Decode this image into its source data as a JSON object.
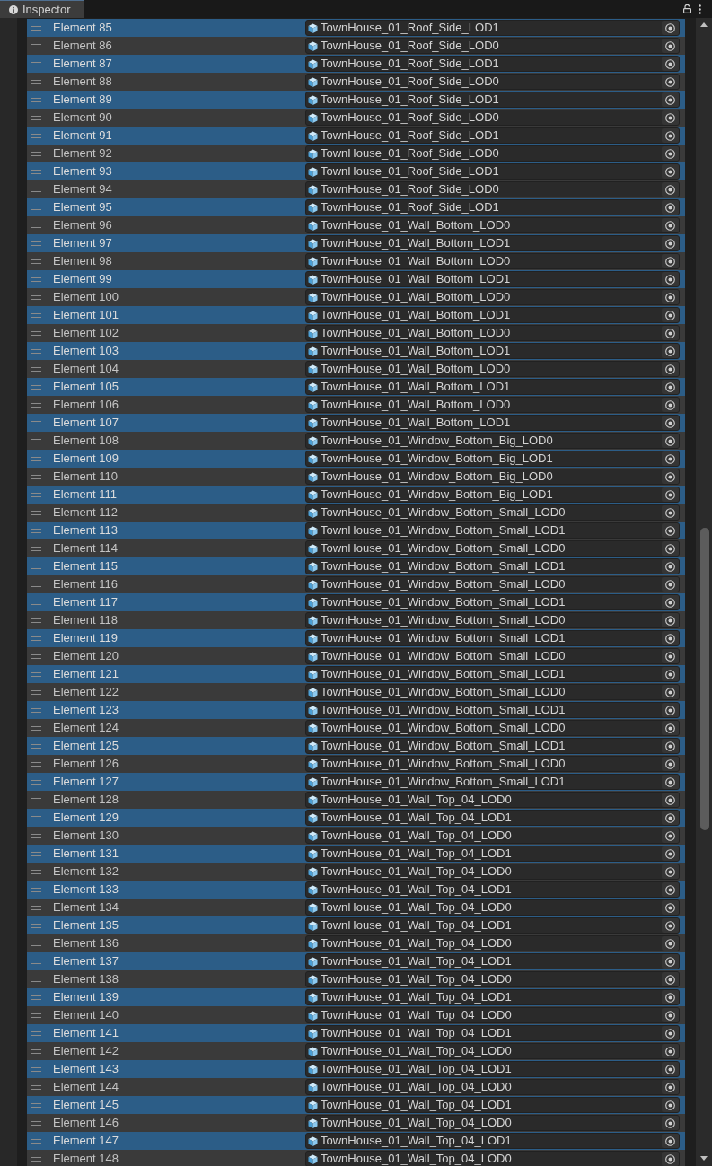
{
  "tab": {
    "title": "Inspector"
  },
  "elements": [
    {
      "label": "Element 85",
      "value": "TownHouse_01_Roof_Side_LOD1",
      "selected": true
    },
    {
      "label": "Element 86",
      "value": "TownHouse_01_Roof_Side_LOD0",
      "selected": false
    },
    {
      "label": "Element 87",
      "value": "TownHouse_01_Roof_Side_LOD1",
      "selected": true
    },
    {
      "label": "Element 88",
      "value": "TownHouse_01_Roof_Side_LOD0",
      "selected": false
    },
    {
      "label": "Element 89",
      "value": "TownHouse_01_Roof_Side_LOD1",
      "selected": true
    },
    {
      "label": "Element 90",
      "value": "TownHouse_01_Roof_Side_LOD0",
      "selected": false
    },
    {
      "label": "Element 91",
      "value": "TownHouse_01_Roof_Side_LOD1",
      "selected": true
    },
    {
      "label": "Element 92",
      "value": "TownHouse_01_Roof_Side_LOD0",
      "selected": false
    },
    {
      "label": "Element 93",
      "value": "TownHouse_01_Roof_Side_LOD1",
      "selected": true
    },
    {
      "label": "Element 94",
      "value": "TownHouse_01_Roof_Side_LOD0",
      "selected": false
    },
    {
      "label": "Element 95",
      "value": "TownHouse_01_Roof_Side_LOD1",
      "selected": true
    },
    {
      "label": "Element 96",
      "value": "TownHouse_01_Wall_Bottom_LOD0",
      "selected": false
    },
    {
      "label": "Element 97",
      "value": "TownHouse_01_Wall_Bottom_LOD1",
      "selected": true
    },
    {
      "label": "Element 98",
      "value": "TownHouse_01_Wall_Bottom_LOD0",
      "selected": false
    },
    {
      "label": "Element 99",
      "value": "TownHouse_01_Wall_Bottom_LOD1",
      "selected": true
    },
    {
      "label": "Element 100",
      "value": "TownHouse_01_Wall_Bottom_LOD0",
      "selected": false
    },
    {
      "label": "Element 101",
      "value": "TownHouse_01_Wall_Bottom_LOD1",
      "selected": true
    },
    {
      "label": "Element 102",
      "value": "TownHouse_01_Wall_Bottom_LOD0",
      "selected": false
    },
    {
      "label": "Element 103",
      "value": "TownHouse_01_Wall_Bottom_LOD1",
      "selected": true
    },
    {
      "label": "Element 104",
      "value": "TownHouse_01_Wall_Bottom_LOD0",
      "selected": false
    },
    {
      "label": "Element 105",
      "value": "TownHouse_01_Wall_Bottom_LOD1",
      "selected": true
    },
    {
      "label": "Element 106",
      "value": "TownHouse_01_Wall_Bottom_LOD0",
      "selected": false
    },
    {
      "label": "Element 107",
      "value": "TownHouse_01_Wall_Bottom_LOD1",
      "selected": true
    },
    {
      "label": "Element 108",
      "value": "TownHouse_01_Window_Bottom_Big_LOD0",
      "selected": false
    },
    {
      "label": "Element 109",
      "value": "TownHouse_01_Window_Bottom_Big_LOD1",
      "selected": true
    },
    {
      "label": "Element 110",
      "value": "TownHouse_01_Window_Bottom_Big_LOD0",
      "selected": false
    },
    {
      "label": "Element 111",
      "value": "TownHouse_01_Window_Bottom_Big_LOD1",
      "selected": true
    },
    {
      "label": "Element 112",
      "value": "TownHouse_01_Window_Bottom_Small_LOD0",
      "selected": false
    },
    {
      "label": "Element 113",
      "value": "TownHouse_01_Window_Bottom_Small_LOD1",
      "selected": true
    },
    {
      "label": "Element 114",
      "value": "TownHouse_01_Window_Bottom_Small_LOD0",
      "selected": false
    },
    {
      "label": "Element 115",
      "value": "TownHouse_01_Window_Bottom_Small_LOD1",
      "selected": true
    },
    {
      "label": "Element 116",
      "value": "TownHouse_01_Window_Bottom_Small_LOD0",
      "selected": false
    },
    {
      "label": "Element 117",
      "value": "TownHouse_01_Window_Bottom_Small_LOD1",
      "selected": true
    },
    {
      "label": "Element 118",
      "value": "TownHouse_01_Window_Bottom_Small_LOD0",
      "selected": false
    },
    {
      "label": "Element 119",
      "value": "TownHouse_01_Window_Bottom_Small_LOD1",
      "selected": true
    },
    {
      "label": "Element 120",
      "value": "TownHouse_01_Window_Bottom_Small_LOD0",
      "selected": false
    },
    {
      "label": "Element 121",
      "value": "TownHouse_01_Window_Bottom_Small_LOD1",
      "selected": true
    },
    {
      "label": "Element 122",
      "value": "TownHouse_01_Window_Bottom_Small_LOD0",
      "selected": false
    },
    {
      "label": "Element 123",
      "value": "TownHouse_01_Window_Bottom_Small_LOD1",
      "selected": true
    },
    {
      "label": "Element 124",
      "value": "TownHouse_01_Window_Bottom_Small_LOD0",
      "selected": false
    },
    {
      "label": "Element 125",
      "value": "TownHouse_01_Window_Bottom_Small_LOD1",
      "selected": true
    },
    {
      "label": "Element 126",
      "value": "TownHouse_01_Window_Bottom_Small_LOD0",
      "selected": false
    },
    {
      "label": "Element 127",
      "value": "TownHouse_01_Window_Bottom_Small_LOD1",
      "selected": true
    },
    {
      "label": "Element 128",
      "value": "TownHouse_01_Wall_Top_04_LOD0",
      "selected": false
    },
    {
      "label": "Element 129",
      "value": "TownHouse_01_Wall_Top_04_LOD1",
      "selected": true
    },
    {
      "label": "Element 130",
      "value": "TownHouse_01_Wall_Top_04_LOD0",
      "selected": false
    },
    {
      "label": "Element 131",
      "value": "TownHouse_01_Wall_Top_04_LOD1",
      "selected": true
    },
    {
      "label": "Element 132",
      "value": "TownHouse_01_Wall_Top_04_LOD0",
      "selected": false
    },
    {
      "label": "Element 133",
      "value": "TownHouse_01_Wall_Top_04_LOD1",
      "selected": true
    },
    {
      "label": "Element 134",
      "value": "TownHouse_01_Wall_Top_04_LOD0",
      "selected": false
    },
    {
      "label": "Element 135",
      "value": "TownHouse_01_Wall_Top_04_LOD1",
      "selected": true
    },
    {
      "label": "Element 136",
      "value": "TownHouse_01_Wall_Top_04_LOD0",
      "selected": false
    },
    {
      "label": "Element 137",
      "value": "TownHouse_01_Wall_Top_04_LOD1",
      "selected": true
    },
    {
      "label": "Element 138",
      "value": "TownHouse_01_Wall_Top_04_LOD0",
      "selected": false
    },
    {
      "label": "Element 139",
      "value": "TownHouse_01_Wall_Top_04_LOD1",
      "selected": true
    },
    {
      "label": "Element 140",
      "value": "TownHouse_01_Wall_Top_04_LOD0",
      "selected": false
    },
    {
      "label": "Element 141",
      "value": "TownHouse_01_Wall_Top_04_LOD1",
      "selected": true
    },
    {
      "label": "Element 142",
      "value": "TownHouse_01_Wall_Top_04_LOD0",
      "selected": false
    },
    {
      "label": "Element 143",
      "value": "TownHouse_01_Wall_Top_04_LOD1",
      "selected": true
    },
    {
      "label": "Element 144",
      "value": "TownHouse_01_Wall_Top_04_LOD0",
      "selected": false
    },
    {
      "label": "Element 145",
      "value": "TownHouse_01_Wall_Top_04_LOD1",
      "selected": true
    },
    {
      "label": "Element 146",
      "value": "TownHouse_01_Wall_Top_04_LOD0",
      "selected": false
    },
    {
      "label": "Element 147",
      "value": "TownHouse_01_Wall_Top_04_LOD1",
      "selected": true
    },
    {
      "label": "Element 148",
      "value": "TownHouse_01_Wall_Top_04_LOD0",
      "selected": false
    }
  ]
}
